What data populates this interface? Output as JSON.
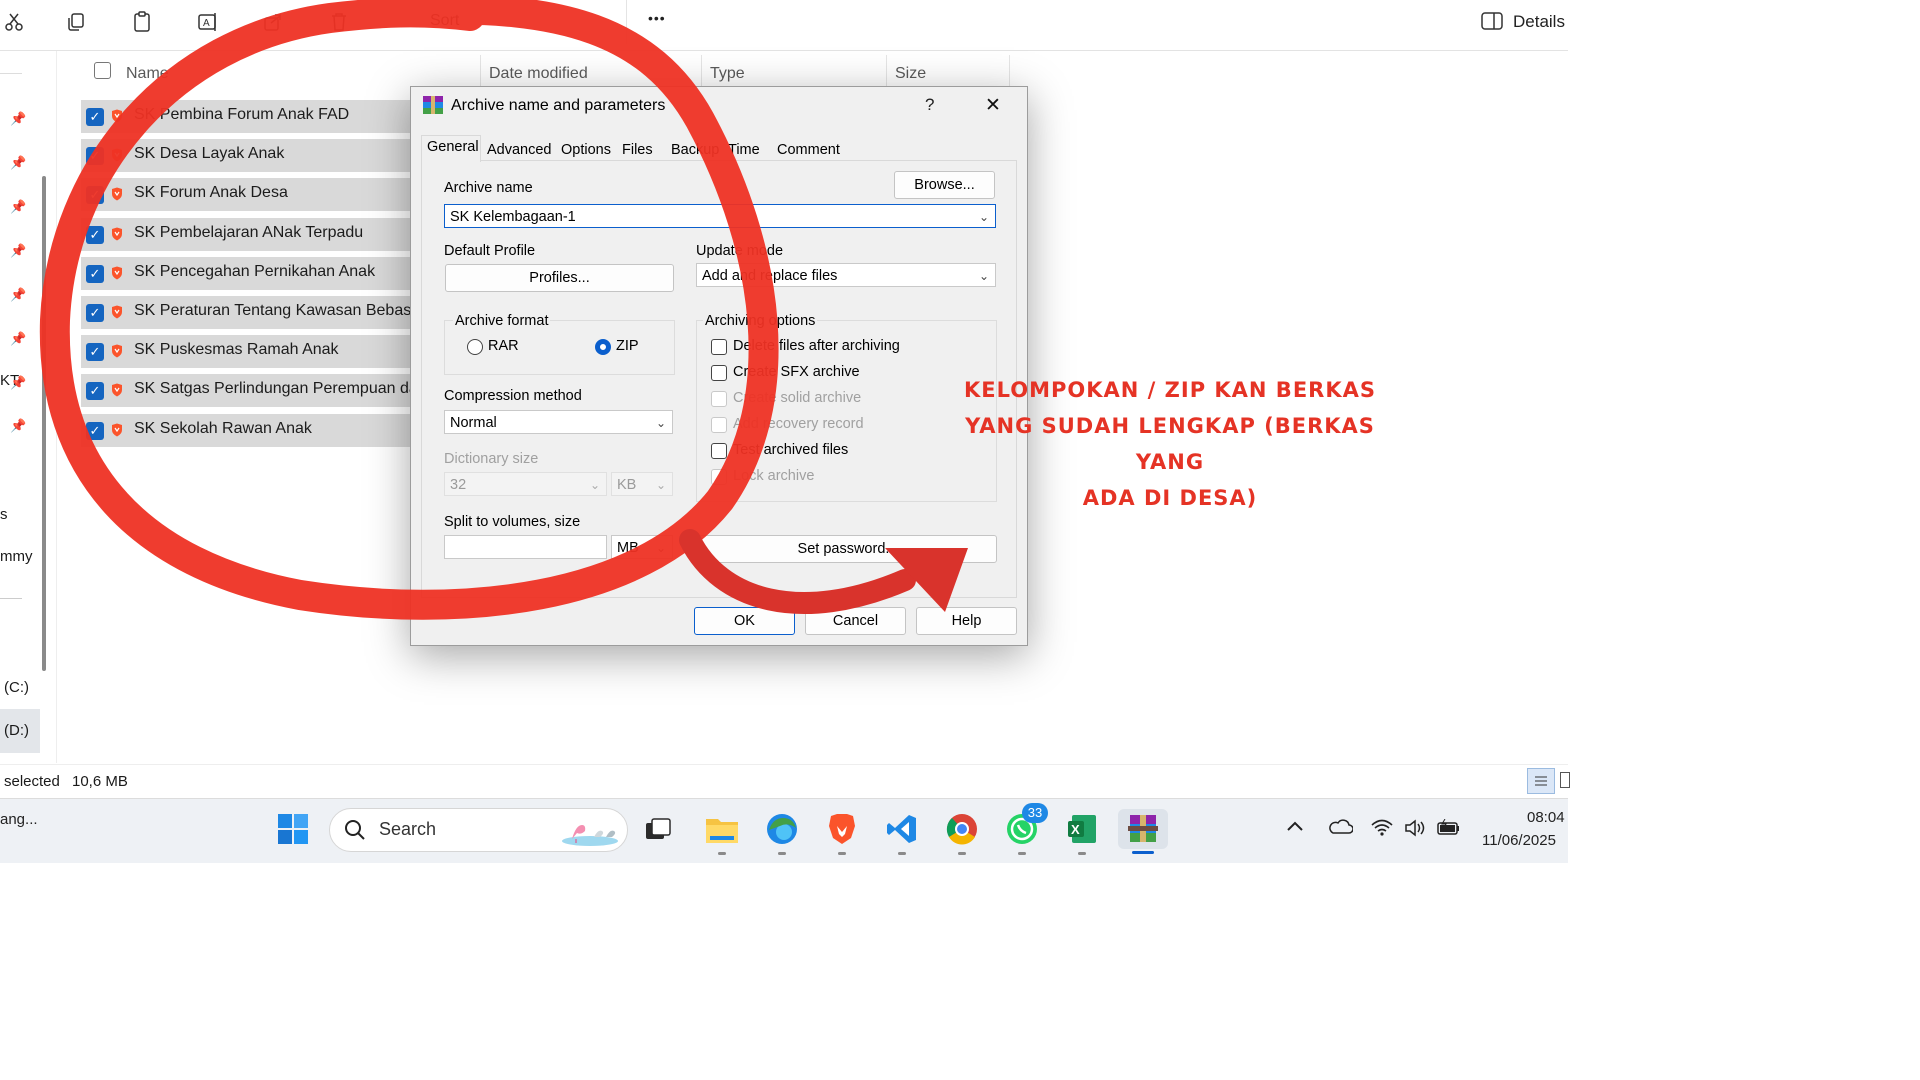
{
  "toolbar": {
    "sort_label": "Sort",
    "more_label": "•••",
    "details_label": "Details"
  },
  "file_list": {
    "columns": [
      "Name",
      "Date modified",
      "Type",
      "Size"
    ],
    "rows": [
      {
        "name": "SK Pembina Forum Anak FAD"
      },
      {
        "name": "SK Desa Layak Anak"
      },
      {
        "name": "SK Forum Anak Desa"
      },
      {
        "name": "SK Pembelajaran ANak Terpadu"
      },
      {
        "name": "SK Pencegahan Pernikahan Anak"
      },
      {
        "name": "SK Peraturan Tentang Kawasan Bebas R"
      },
      {
        "name": "SK Puskesmas Ramah Anak"
      },
      {
        "name": "SK Satgas Perlindungan Perempuan dan"
      },
      {
        "name": "SK Sekolah Rawan Anak"
      }
    ]
  },
  "left_nav": {
    "items": [
      "KT",
      "s",
      "mmy",
      "(C:)",
      "(D:)"
    ]
  },
  "status": {
    "selection": "selected",
    "size": "10,6 MB"
  },
  "dialog": {
    "title": "Archive name and parameters",
    "help_glyph": "?",
    "close_glyph": "✕",
    "tabs": [
      "General",
      "Advanced",
      "Options",
      "Files",
      "Backup",
      "Time",
      "Comment"
    ],
    "archive_name_label": "Archive name",
    "archive_name_value": "SK Kelembagaan-1",
    "browse_label": "Browse...",
    "default_profile_label": "Default Profile",
    "profiles_button": "Profiles...",
    "update_mode_label": "Update mode",
    "update_mode_value": "Add and replace files",
    "archive_format_label": "Archive format",
    "format_rar": "RAR",
    "format_zip": "ZIP",
    "selected_format": "ZIP",
    "compression_method_label": "Compression method",
    "compression_method_value": "Normal",
    "dictionary_size_label": "Dictionary size",
    "dictionary_size_value": "32",
    "dictionary_unit": "KB",
    "split_label": "Split to volumes, size",
    "split_value": "",
    "split_unit": "MB",
    "archiving_options_label": "Archiving options",
    "options": [
      {
        "label": "Delete files after archiving",
        "checked": false,
        "enabled": true
      },
      {
        "label": "Create SFX archive",
        "checked": false,
        "enabled": true
      },
      {
        "label": "Create solid archive",
        "checked": false,
        "enabled": false
      },
      {
        "label": "Add recovery record",
        "checked": false,
        "enabled": false
      },
      {
        "label": "Test archived files",
        "checked": false,
        "enabled": true
      },
      {
        "label": "Lock archive",
        "checked": false,
        "enabled": false
      }
    ],
    "set_password_label": "Set password...",
    "ok_label": "OK",
    "cancel_label": "Cancel",
    "help_label": "Help"
  },
  "annotation": {
    "lines": [
      "KELOMPOKAN / ZIP KAN BERKAS",
      "YANG SUDAH LENGKAP (BERKAS YANG",
      "ADA DI DESA)"
    ],
    "color": "#e53325"
  },
  "taskbar": {
    "search_label": "Search",
    "left_status": "ang...",
    "whatsapp_badge": "33",
    "time": "08:04",
    "date": "11/06/2025"
  }
}
